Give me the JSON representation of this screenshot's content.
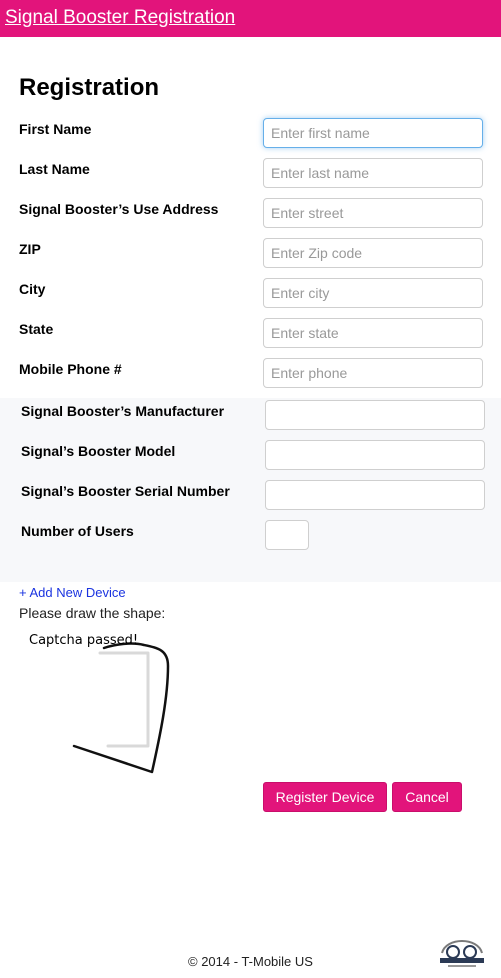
{
  "header": {
    "title": "Signal Booster Registration"
  },
  "form": {
    "heading": "Registration",
    "fields": [
      {
        "label": "First Name",
        "placeholder": "Enter first name"
      },
      {
        "label": "Last Name",
        "placeholder": "Enter last name"
      },
      {
        "label": "Signal Booster’s Use Address",
        "placeholder": "Enter street"
      },
      {
        "label": "ZIP",
        "placeholder": "Enter Zip code"
      },
      {
        "label": "City",
        "placeholder": "Enter city"
      },
      {
        "label": "State",
        "placeholder": "Enter state"
      },
      {
        "label": "Mobile Phone #",
        "placeholder": "Enter phone"
      }
    ],
    "device_fields": [
      {
        "label": "Signal Booster’s Manufacturer",
        "value": ""
      },
      {
        "label": "Signal’s Booster Model",
        "value": ""
      },
      {
        "label": "Signal’s Booster Serial Number",
        "value": ""
      },
      {
        "label": "Number of Users",
        "value": ""
      }
    ],
    "add_device_label": "+ Add New Device"
  },
  "captcha": {
    "instruction": "Please draw the shape:",
    "status": "Captcha passed!"
  },
  "actions": {
    "register_label": "Register Device",
    "cancel_label": "Cancel"
  },
  "footer": {
    "copyright": "© 2014 - T-Mobile US"
  },
  "colors": {
    "brand": "#e2147b",
    "link": "#1a33e0",
    "focus": "#66afe9"
  }
}
